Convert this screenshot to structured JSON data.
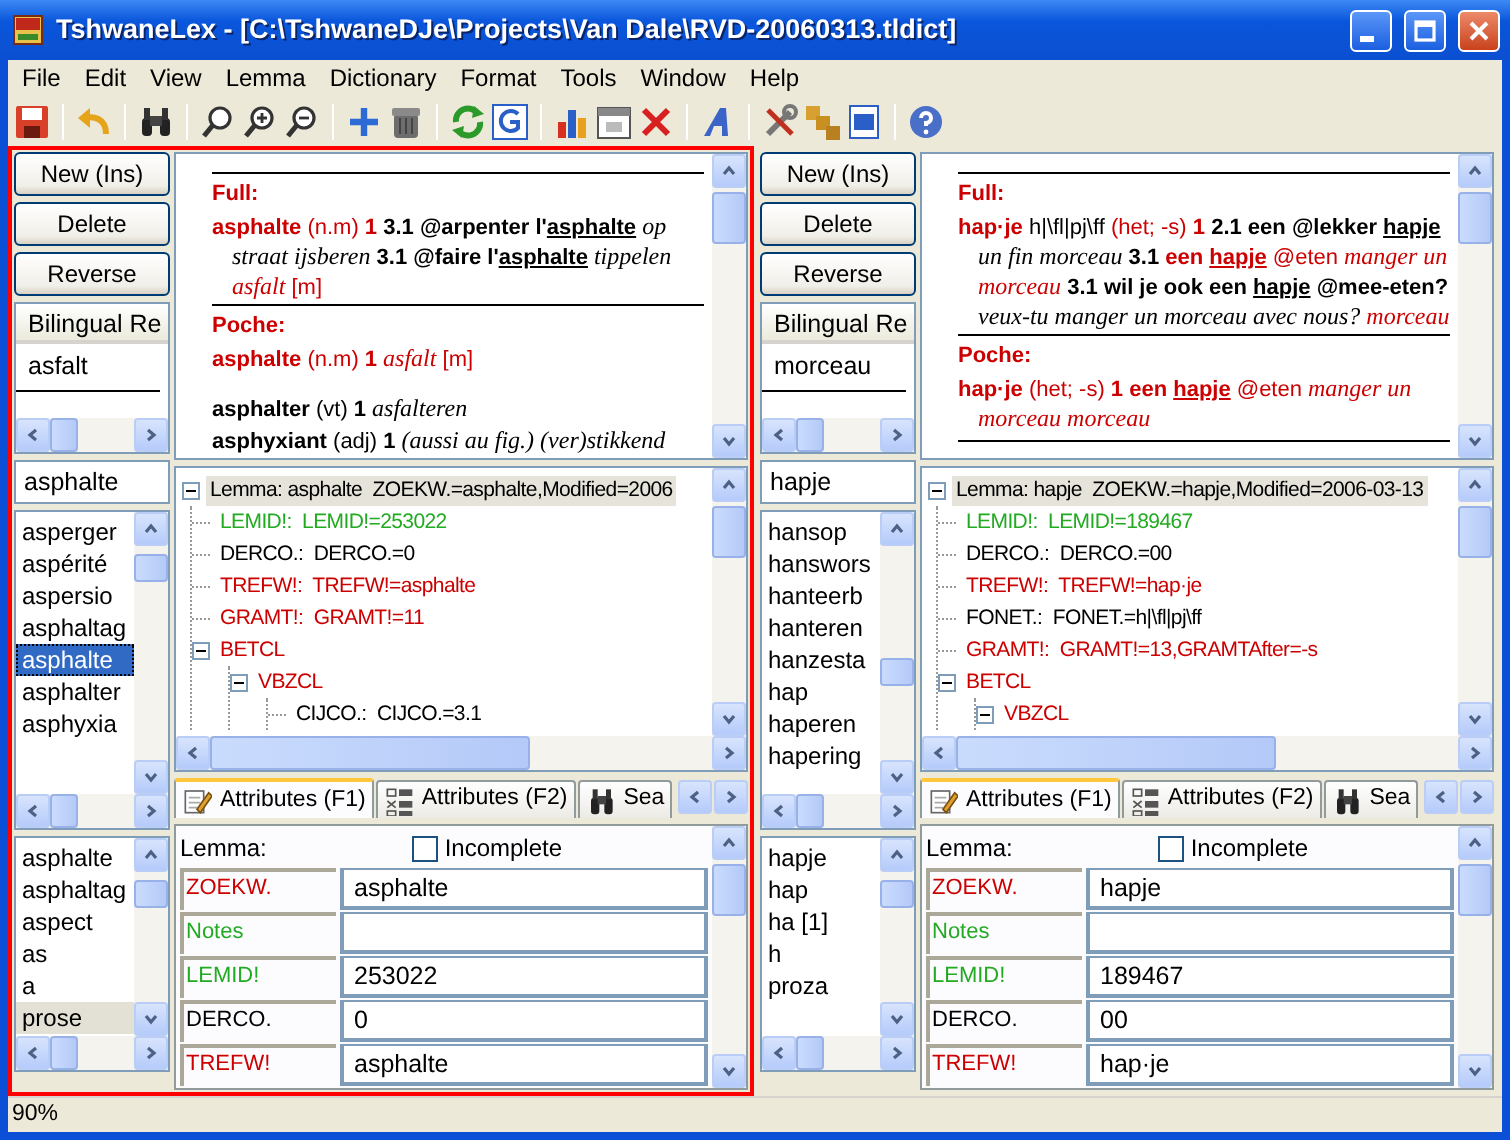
{
  "window": {
    "title": "TshwaneLex - [C:\\TshwaneDJe\\Projects\\Van Dale\\RVD-20060313.tldict]"
  },
  "menu": [
    "File",
    "Edit",
    "View",
    "Lemma",
    "Dictionary",
    "Format",
    "Tools",
    "Window",
    "Help"
  ],
  "panes": [
    {
      "active": true,
      "buttons": [
        "New (Ins)",
        "Delete",
        "Reverse"
      ],
      "bilingual": {
        "header": "Bilingual Re",
        "items": [
          "asfalt"
        ]
      },
      "search": {
        "value": "asphalte"
      },
      "lemma_list": [
        {
          "text": "asperger",
          "selected": false
        },
        {
          "text": "aspérité",
          "selected": false
        },
        {
          "text": "aspersio",
          "selected": false
        },
        {
          "text": "asphaltag",
          "selected": false
        },
        {
          "text": "asphalte",
          "selected": true
        },
        {
          "text": "asphalter",
          "selected": false
        },
        {
          "text": "asphyxia",
          "selected": false
        }
      ],
      "history": [
        {
          "text": "asphalte",
          "selected": false
        },
        {
          "text": "asphaltag",
          "selected": false
        },
        {
          "text": "aspect",
          "selected": false
        },
        {
          "text": "as",
          "selected": false
        },
        {
          "text": "a",
          "selected": false
        },
        {
          "text": "prose",
          "selected": true
        }
      ],
      "preview": {
        "sections": [
          {
            "title": "Full:",
            "entries": [
              [
                {
                  "kind": "hw",
                  "text": "asphalte"
                },
                {
                  "kind": "gram",
                  "text": " (n.m) "
                },
                {
                  "kind": "rb",
                  "text": "1"
                },
                {
                  "kind": "b",
                  "text": " 3.1 @arpenter l'"
                },
                {
                  "kind": "bu",
                  "text": "asphalte"
                },
                {
                  "kind": "i",
                  "text": " op straat ijsberen"
                },
                {
                  "kind": "b",
                  "text": " 3.1 @faire l'"
                },
                {
                  "kind": "bu",
                  "text": "asphalte"
                },
                {
                  "kind": "i",
                  "text": " tippelen "
                },
                {
                  "kind": "ri",
                  "text": "asfalt"
                },
                {
                  "kind": "r",
                  "text": " [m]"
                }
              ]
            ]
          },
          {
            "title": "Poche:",
            "entries": [
              [
                {
                  "kind": "hw",
                  "text": "asphalte"
                },
                {
                  "kind": "gram",
                  "text": " (n.m) "
                },
                {
                  "kind": "rb",
                  "text": "1"
                },
                {
                  "kind": "ri",
                  "text": " asfalt"
                },
                {
                  "kind": "r",
                  "text": " [m]"
                }
              ]
            ]
          }
        ],
        "more": [
          [
            {
              "kind": "b",
              "text": "asphalter"
            },
            {
              "kind": "n",
              "text": " (vt) "
            },
            {
              "kind": "b",
              "text": "1"
            },
            {
              "kind": "i",
              "text": " asfalteren"
            }
          ],
          [
            {
              "kind": "b",
              "text": "asphyxiant"
            },
            {
              "kind": "n",
              "text": " (adj) "
            },
            {
              "kind": "b",
              "text": "1"
            },
            {
              "kind": "i",
              "text": " (aussi au fig.) (ver)stikkend"
            }
          ]
        ]
      },
      "tree": [
        {
          "text": "Lemma: asphalte  ZOEKW.=asphalte,Modified=2006",
          "color": "#000000",
          "selected": true,
          "expanded": true,
          "children": [
            {
              "text": "LEMID!:  LEMID!=253022",
              "color": "#22aa22",
              "selected": false
            },
            {
              "text": "DERCO.:  DERCO.=0",
              "color": "#000000",
              "selected": false
            },
            {
              "text": "TREFW!:  TREFW!=asphalte",
              "color": "#cc0000",
              "selected": false
            },
            {
              "text": "GRAMT!:  GRAMT!=11",
              "color": "#cc0000",
              "selected": false
            },
            {
              "text": "BETCL",
              "color": "#cc0000",
              "selected": false,
              "expanded": true,
              "children": [
                {
                  "text": "VBZCL",
                  "color": "#cc0000",
                  "selected": false,
                  "expanded": true,
                  "children": [
                    {
                      "text": "CIJCO.:  CIJCO.=3.1",
                      "color": "#000000",
                      "selected": false
                    }
                  ]
                }
              ]
            }
          ]
        }
      ],
      "tabs": [
        {
          "label": "Attributes (F1)",
          "selected": true
        },
        {
          "label": "Attributes (F2)",
          "selected": false
        },
        {
          "label": "Sea",
          "selected": false
        }
      ],
      "attributes": {
        "title": "Lemma:",
        "incomplete": {
          "label": "Incomplete",
          "checked": false
        },
        "rows": [
          {
            "label": "ZOEKW.",
            "color": "#cc0000",
            "value": "asphalte"
          },
          {
            "label": "Notes",
            "color": "#22aa22"
          },
          {
            "label": "LEMID!",
            "color": "#22aa22",
            "value": "253022"
          },
          {
            "label": "DERCO.",
            "color": "#000000",
            "value": "0"
          },
          {
            "label": "TREFW!",
            "color": "#cc0000",
            "value": "asphalte"
          }
        ]
      }
    },
    {
      "active": false,
      "buttons": [
        "New (Ins)",
        "Delete",
        "Reverse"
      ],
      "bilingual": {
        "header": "Bilingual Re",
        "items": [
          "morceau"
        ]
      },
      "search": {
        "value": "hapje"
      },
      "lemma_list": [
        {
          "text": "hansop",
          "selected": false
        },
        {
          "text": "hanswors",
          "selected": false
        },
        {
          "text": "hanteerb",
          "selected": false
        },
        {
          "text": "hanteren",
          "selected": false
        },
        {
          "text": "hanzesta",
          "selected": false
        },
        {
          "text": "hap",
          "selected": false
        },
        {
          "text": "haperen",
          "selected": false
        },
        {
          "text": "hapering",
          "selected": false
        }
      ],
      "history": [
        {
          "text": "hapje",
          "selected": false
        },
        {
          "text": "hap",
          "selected": false
        },
        {
          "text": "ha [1]",
          "selected": false
        },
        {
          "text": "h",
          "selected": false
        },
        {
          "text": "proza",
          "selected": false
        }
      ],
      "preview": {
        "sections": [
          {
            "title": "Full:",
            "entries": [
              [
                {
                  "kind": "hw",
                  "text": "hap·je"
                },
                {
                  "kind": "n",
                  "text": " h|\\fl|pj\\ff "
                },
                {
                  "kind": "gram",
                  "text": "(het; -s) "
                },
                {
                  "kind": "rb",
                  "text": "1"
                },
                {
                  "kind": "b",
                  "text": " 2.1 een @lekker "
                },
                {
                  "kind": "bu",
                  "text": "hapje"
                },
                {
                  "kind": "i",
                  "text": " un fin morceau"
                },
                {
                  "kind": "b",
                  "text": " 3.1 "
                },
                {
                  "kind": "rb",
                  "text": "een "
                },
                {
                  "kind": "rbu",
                  "text": "hapje"
                },
                {
                  "kind": "r",
                  "text": " @eten"
                },
                {
                  "kind": "ri",
                  "text": " manger un morceau"
                },
                {
                  "kind": "b",
                  "text": " 3.1 wil je ook een "
                },
                {
                  "kind": "bu",
                  "text": "hapje"
                },
                {
                  "kind": "b",
                  "text": " @mee-eten?"
                },
                {
                  "kind": "i",
                  "text": " veux-tu manger un morceau avec nous? "
                },
                {
                  "kind": "ri",
                  "text": "morceau"
                }
              ]
            ]
          },
          {
            "title": "Poche:",
            "entries": [
              [
                {
                  "kind": "hw",
                  "text": "hap·je"
                },
                {
                  "kind": "gram",
                  "text": " (het; -s) "
                },
                {
                  "kind": "rb",
                  "text": "1 een "
                },
                {
                  "kind": "rbu",
                  "text": "hapje"
                },
                {
                  "kind": "r",
                  "text": " @eten"
                },
                {
                  "kind": "ri",
                  "text": " manger un morceau morceau"
                }
              ]
            ]
          }
        ]
      },
      "tree": [
        {
          "text": "Lemma: hapje  ZOEKW.=hapje,Modified=2006-03-13",
          "color": "#000000",
          "selected": true,
          "expanded": true,
          "children": [
            {
              "text": "LEMID!:  LEMID!=189467",
              "color": "#22aa22",
              "selected": false
            },
            {
              "text": "DERCO.:  DERCO.=00",
              "color": "#000000",
              "selected": false
            },
            {
              "text": "TREFW!:  TREFW!=hap·je",
              "color": "#cc0000",
              "selected": false
            },
            {
              "text": "FONET.:  FONET.=h|\\fl|pj\\ff",
              "color": "#000000",
              "selected": false
            },
            {
              "text": "GRAMT!:  GRAMT!=13,GRAMTAfter=-s",
              "color": "#cc0000",
              "selected": false
            },
            {
              "text": "BETCL",
              "color": "#cc0000",
              "selected": false,
              "expanded": true,
              "children": [
                {
                  "text": "VBZCL",
                  "color": "#cc0000",
                  "selected": false,
                  "expanded": true
                }
              ]
            }
          ]
        }
      ],
      "tabs": [
        {
          "label": "Attributes (F1)",
          "selected": true
        },
        {
          "label": "Attributes (F2)",
          "selected": false
        },
        {
          "label": "Sea",
          "selected": false
        }
      ],
      "attributes": {
        "title": "Lemma:",
        "incomplete": {
          "label": "Incomplete",
          "checked": false
        },
        "rows": [
          {
            "label": "ZOEKW.",
            "color": "#cc0000",
            "value": "hapje"
          },
          {
            "label": "Notes",
            "color": "#22aa22"
          },
          {
            "label": "LEMID!",
            "color": "#22aa22",
            "value": "189467"
          },
          {
            "label": "DERCO.",
            "color": "#000000",
            "value": "00"
          },
          {
            "label": "TREFW!",
            "color": "#cc0000",
            "value": "hap·je"
          }
        ]
      }
    }
  ],
  "status_bar": {
    "zoom": "90%"
  }
}
